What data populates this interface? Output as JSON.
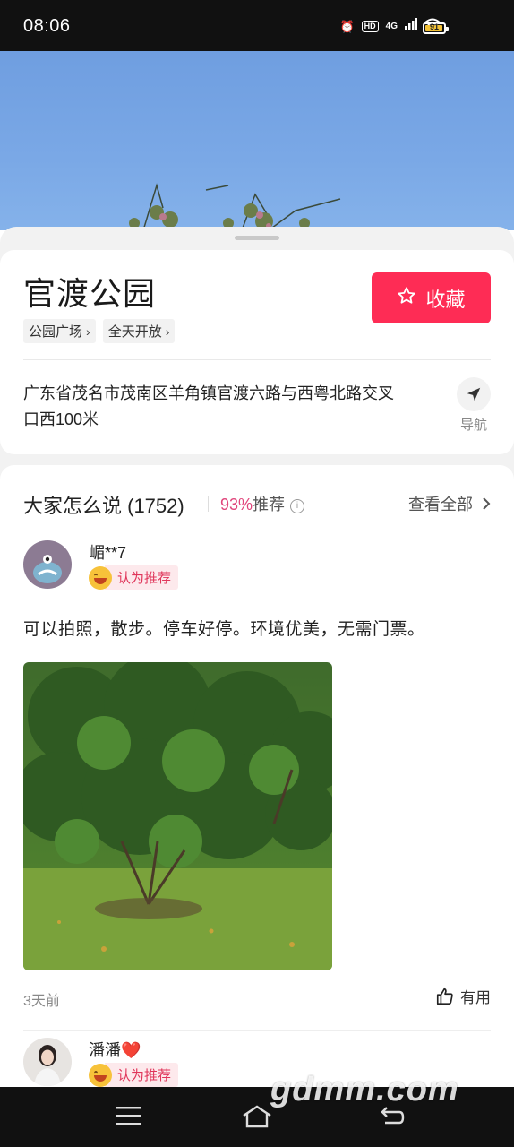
{
  "status_bar": {
    "time": "08:06",
    "network": "4G",
    "battery": "91"
  },
  "place": {
    "title": "官渡公园",
    "tags": [
      {
        "label": "公园广场"
      },
      {
        "label": "全天开放"
      }
    ],
    "favorite_label": "收藏",
    "address": "广东省茂名市茂南区羊角镇官渡六路与西粤北路交叉口西100米",
    "nav_label": "导航"
  },
  "reviews_section": {
    "title": "大家怎么说 (1752)",
    "recommend_pct": "93%",
    "recommend_label": "推荐",
    "see_all": "查看全部",
    "reviews": [
      {
        "username": "嵋**7",
        "badge": "认为推荐",
        "text": "可以拍照，散步。停车好停。环境优美，无需门票。",
        "time": "3天前",
        "useful_label": "有用"
      },
      {
        "username": "潘潘❤️",
        "badge": "认为推荐"
      }
    ]
  },
  "watermark": "gdmm.com",
  "colors": {
    "accent": "#fe2c55",
    "recommend": "#e0457b"
  }
}
